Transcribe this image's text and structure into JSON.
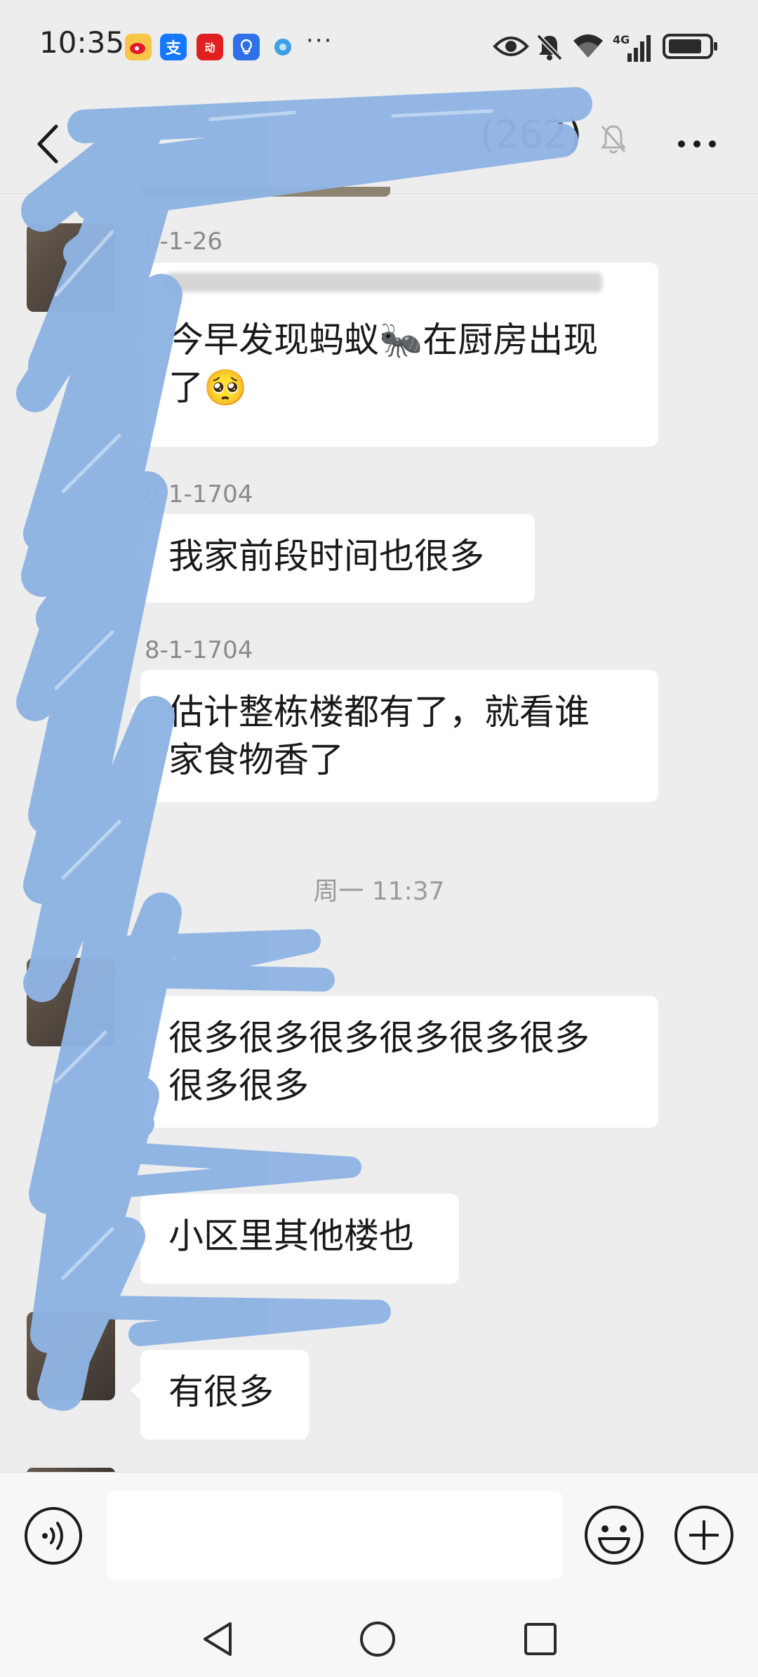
{
  "status_bar": {
    "time": "10:35",
    "overflow_dots": "···",
    "network": "4G"
  },
  "header": {
    "title": "(262)"
  },
  "messages": [
    {
      "sender": "8-1-26",
      "text": "今早发现蚂蚁🐜在厨房出现\n了🥺"
    },
    {
      "sender": "8-1-1704",
      "text": "我家前段时间也很多"
    },
    {
      "sender": "8-1-1704",
      "text": "估计整栋楼都有了，就看谁\n家食物香了"
    },
    {
      "timestamp": "周一 11:37"
    },
    {
      "sender": "",
      "text": "很多很多很多很多很多很多\n很多很多"
    },
    {
      "sender": "",
      "text": "小区里其他楼也"
    },
    {
      "sender": "",
      "text": "有很多"
    }
  ],
  "input": {
    "placeholder": ""
  },
  "colors": {
    "background": "#ededed",
    "bubble": "#ffffff",
    "scribble": "#8fb4e3"
  }
}
